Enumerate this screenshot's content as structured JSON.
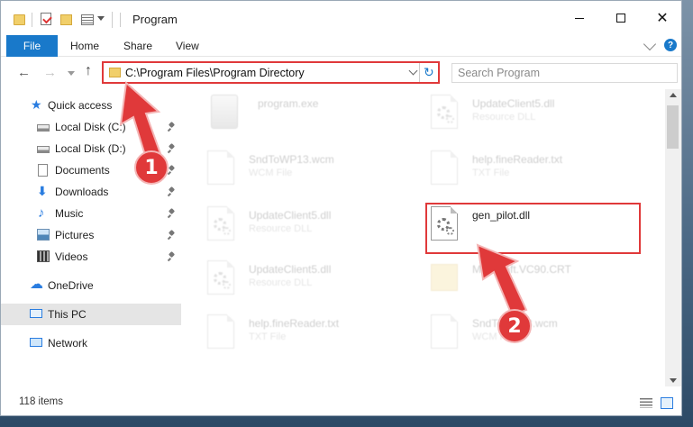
{
  "window": {
    "title": "Program",
    "minimize_glyph": "",
    "close_glyph": "✕"
  },
  "ribbon": {
    "file": "File",
    "home": "Home",
    "share": "Share",
    "view": "View",
    "help_glyph": "?"
  },
  "nav": {
    "back_glyph": "←",
    "forward_glyph": "→",
    "up_glyph": "↑",
    "address": "C:\\Program Files\\Program Directory",
    "refresh_glyph": "↻",
    "search_placeholder": "Search Program"
  },
  "sidebar": {
    "items": [
      {
        "label": "Quick access",
        "icon": "star-icon"
      },
      {
        "label": "Local Disk (C:)",
        "icon": "disk-icon",
        "pinned": true
      },
      {
        "label": "Local Disk (D:)",
        "icon": "disk-icon",
        "pinned": true
      },
      {
        "label": "Documents",
        "icon": "documents-icon",
        "pinned": true
      },
      {
        "label": "Downloads",
        "icon": "download-icon",
        "pinned": true
      },
      {
        "label": "Music",
        "icon": "music-icon",
        "pinned": true
      },
      {
        "label": "Pictures",
        "icon": "pictures-icon",
        "pinned": true
      },
      {
        "label": "Videos",
        "icon": "videos-icon",
        "pinned": true
      },
      {
        "label": "OneDrive",
        "icon": "cloud-icon"
      },
      {
        "label": "This PC",
        "icon": "computer-icon",
        "selected": true
      },
      {
        "label": "Network",
        "icon": "network-icon"
      }
    ],
    "glyphs": {
      "star": "★",
      "download": "⬇",
      "music": "♪",
      "cloud": "☁"
    }
  },
  "files": [
    {
      "name": "program.exe",
      "type": "",
      "icon": "exe-icon"
    },
    {
      "name": "UpdateClient5.dll",
      "type": "Resource DLL",
      "icon": "dll-icon"
    },
    {
      "name": "SndToWP13.wcm",
      "type": "WCM File",
      "icon": "document-icon"
    },
    {
      "name": "help.fineReader.txt",
      "type": "TXT File",
      "icon": "document-icon"
    },
    {
      "name": "UpdateClient5.dll",
      "type": "Resource DLL",
      "icon": "dll-icon"
    },
    {
      "name": "gen_pilot.dll",
      "type": "",
      "icon": "dll-icon",
      "highlighted": true
    },
    {
      "name": "UpdateClient5.dll",
      "type": "Resource DLL",
      "icon": "dll-icon"
    },
    {
      "name": "Microsoft.VC90.CRT",
      "type": "",
      "icon": "folder-icon"
    },
    {
      "name": "help.fineReader.txt",
      "type": "TXT File",
      "icon": "document-icon"
    },
    {
      "name": "SndToWP13.wcm",
      "type": "WCM File",
      "icon": "document-icon"
    }
  ],
  "status": {
    "item_count": "118 items"
  },
  "callouts": {
    "one": "1",
    "two": "2"
  },
  "colors": {
    "accent": "#1979ca",
    "highlight": "#e0393a"
  }
}
